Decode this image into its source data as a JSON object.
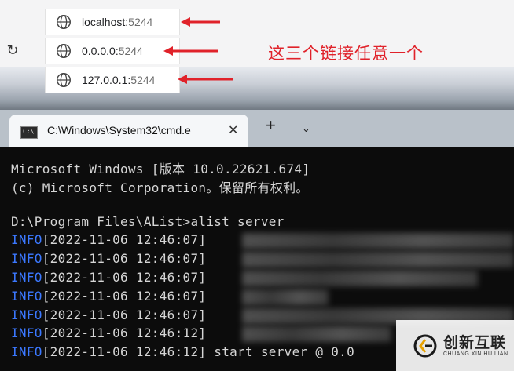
{
  "browser": {
    "suggestions": [
      {
        "host": "localhost:",
        "port": "5244"
      },
      {
        "host": "0.0.0.0:",
        "port": "5244"
      },
      {
        "host": "127.0.0.1:",
        "port": "5244"
      }
    ],
    "note": "这三个链接任意一个",
    "refresh_icon": "refresh-icon",
    "globe_icon": "globe-icon",
    "note_color": "#e0222a"
  },
  "terminal": {
    "tab_title": "C:\\Windows\\System32\\cmd.e",
    "close": "✕",
    "new_tab": "+",
    "dropdown": "⌄",
    "lines": {
      "l1": "Microsoft Windows [版本 10.0.22621.674]",
      "l2": "(c) Microsoft Corporation。保留所有权利。",
      "l3": "D:\\Program Files\\AList>alist server",
      "info": "INFO",
      "t1": "[2022-11-06 12:46:07]",
      "t2": "[2022-11-06 12:46:07]",
      "t3": "[2022-11-06 12:46:07]",
      "t4": "[2022-11-06 12:46:07]",
      "t5": "[2022-11-06 12:46:07]",
      "t6": "[2022-11-06 12:46:12]",
      "t7": "[2022-11-06 12:46:12] start server @ 0.0"
    },
    "info_color": "#3b78ff"
  },
  "watermark": {
    "text": "创新互联",
    "sub": "CHUANG XIN HU LIAN"
  }
}
